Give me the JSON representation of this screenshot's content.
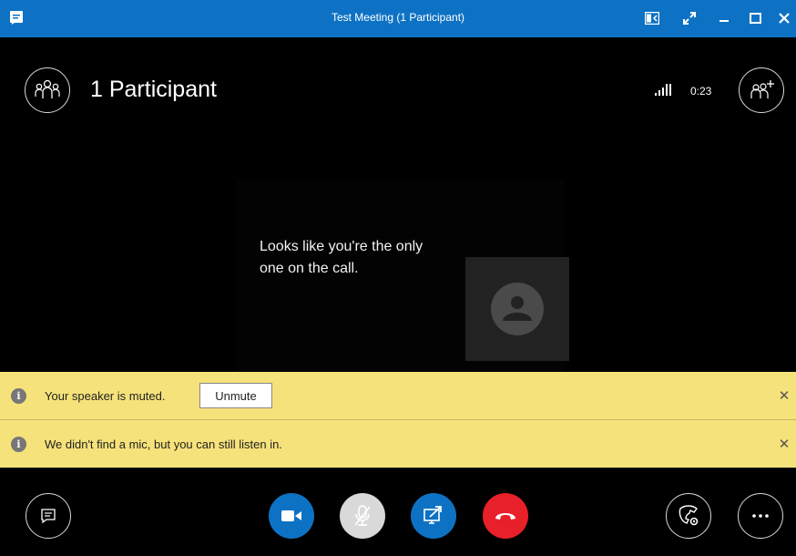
{
  "window": {
    "title": "Test Meeting (1 Participant)",
    "accent_color": "#0e72c4",
    "controls": [
      "compact-view-icon",
      "fullscreen-icon",
      "minimize-icon",
      "maximize-icon",
      "close-icon"
    ]
  },
  "header": {
    "participants_label": "1 Participant",
    "signal_icon": "signal-strength-icon",
    "timer": "0:23"
  },
  "stage": {
    "message": "Looks like you're the only one on the call.",
    "avatar_icon": "person-avatar-icon"
  },
  "notifications": [
    {
      "text": "Your speaker is muted.",
      "action_label": "Unmute",
      "color": "#f6e27a"
    },
    {
      "text": "We didn't find a mic, but you can still listen in.",
      "color": "#f6e27a"
    }
  ],
  "toolbar": {
    "buttons": [
      {
        "icon": "chat-icon"
      },
      {
        "icon": "video-camera-icon",
        "color": "#0e72c4"
      },
      {
        "icon": "mic-muted-icon",
        "color": "#d9d9d9"
      },
      {
        "icon": "share-screen-icon",
        "color": "#0e72c4"
      },
      {
        "icon": "hang-up-icon",
        "color": "#e8202a"
      },
      {
        "icon": "call-controls-icon"
      },
      {
        "icon": "more-options-icon"
      }
    ]
  }
}
